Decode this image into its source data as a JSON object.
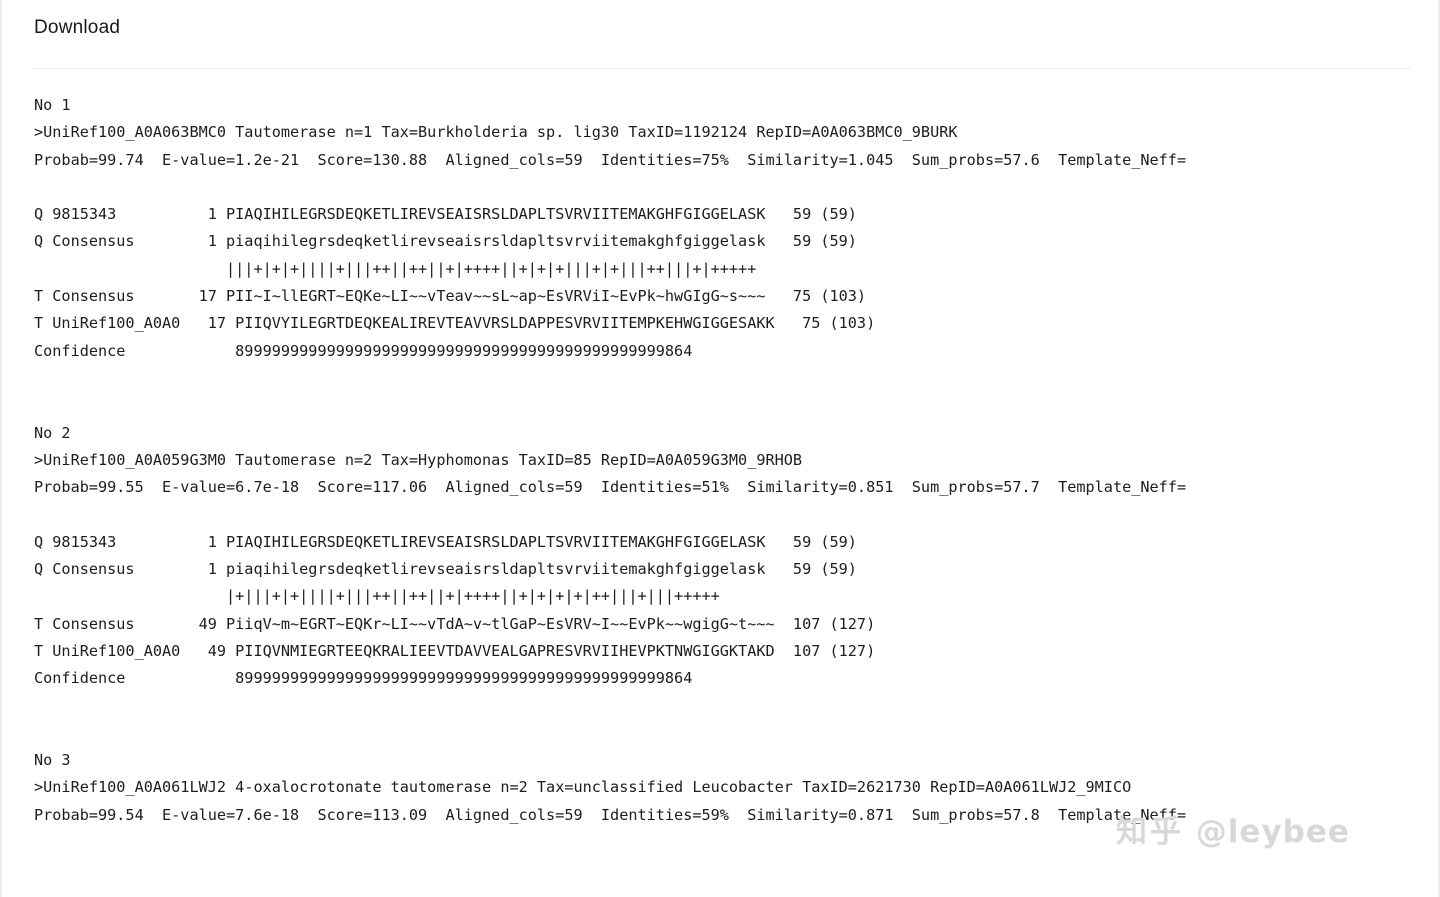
{
  "header": {
    "title": "Download"
  },
  "watermark": {
    "cn": "知乎",
    "handle": "@leybee"
  },
  "results": [
    {
      "no_label": "No 1",
      "description": ">UniRef100_A0A063BMC0 Tautomerase n=1 Tax=Burkholderia sp. lig30 TaxID=1192124 RepID=A0A063BMC0_9BURK",
      "stats": "Probab=99.74  E-value=1.2e-21  Score=130.88  Aligned_cols=59  Identities=75%  Similarity=1.045  Sum_probs=57.6  Template_Neff=",
      "rows": [
        "Q 9815343          1 PIAQIHILEGRSDEQKETLIREVSEAISRSLDAPLTSVRVIITEMAKGHFGIGGELASK   59 (59)",
        "Q Consensus        1 piaqihilegrsdeqketlirevseaisrsldapltsvrviitemakghfgiggelask   59 (59)",
        "                     |||+|+|+||||+|||++||++||+|++++||+|+|+|||+|+|||++|||+|+++++",
        "T Consensus       17 PII~I~llEGRT~EQKe~LI~~vTeav~~sL~ap~EsVRViI~EvPk~hwGIgG~s~~~   75 (103)",
        "T UniRef100_A0A0   17 PIIQVYILEGRTDEQKEALIREVTEAVVRSLDAPPESVRVIITEMPKEHWGIGGESAKK   75 (103)",
        "Confidence            89999999999999999999999999999999999999999999999864"
      ]
    },
    {
      "no_label": "No 2",
      "description": ">UniRef100_A0A059G3M0 Tautomerase n=2 Tax=Hyphomonas TaxID=85 RepID=A0A059G3M0_9RHOB",
      "stats": "Probab=99.55  E-value=6.7e-18  Score=117.06  Aligned_cols=59  Identities=51%  Similarity=0.851  Sum_probs=57.7  Template_Neff=",
      "rows": [
        "Q 9815343          1 PIAQIHILEGRSDEQKETLIREVSEAISRSLDAPLTSVRVIITEMAKGHFGIGGELASK   59 (59)",
        "Q Consensus        1 piaqihilegrsdeqketlirevseaisrsldapltsvrviitemakghfgiggelask   59 (59)",
        "                     |+|||+|+||||+|||++||++||+|++++||+|+|+|+|++|||+|||+++++",
        "T Consensus       49 PiiqV~m~EGRT~EQKr~LI~~vTdA~v~tlGaP~EsVRV~I~~EvPk~~wgigG~t~~~  107 (127)",
        "T UniRef100_A0A0   49 PIIQVNMIEGRTEEQKRALIEEVTDAVVEALGAPRESVRVIIHEVPKTNWGIGGKTAKD  107 (127)",
        "Confidence            89999999999999999999999999999999999999999999999864"
      ]
    },
    {
      "no_label": "No 3",
      "description": ">UniRef100_A0A061LWJ2 4-oxalocrotonate tautomerase n=2 Tax=unclassified Leucobacter TaxID=2621730 RepID=A0A061LWJ2_9MICO",
      "stats": "Probab=99.54  E-value=7.6e-18  Score=113.09  Aligned_cols=59  Identities=59%  Similarity=0.871  Sum_probs=57.8  Template_Neff=",
      "rows": []
    }
  ]
}
